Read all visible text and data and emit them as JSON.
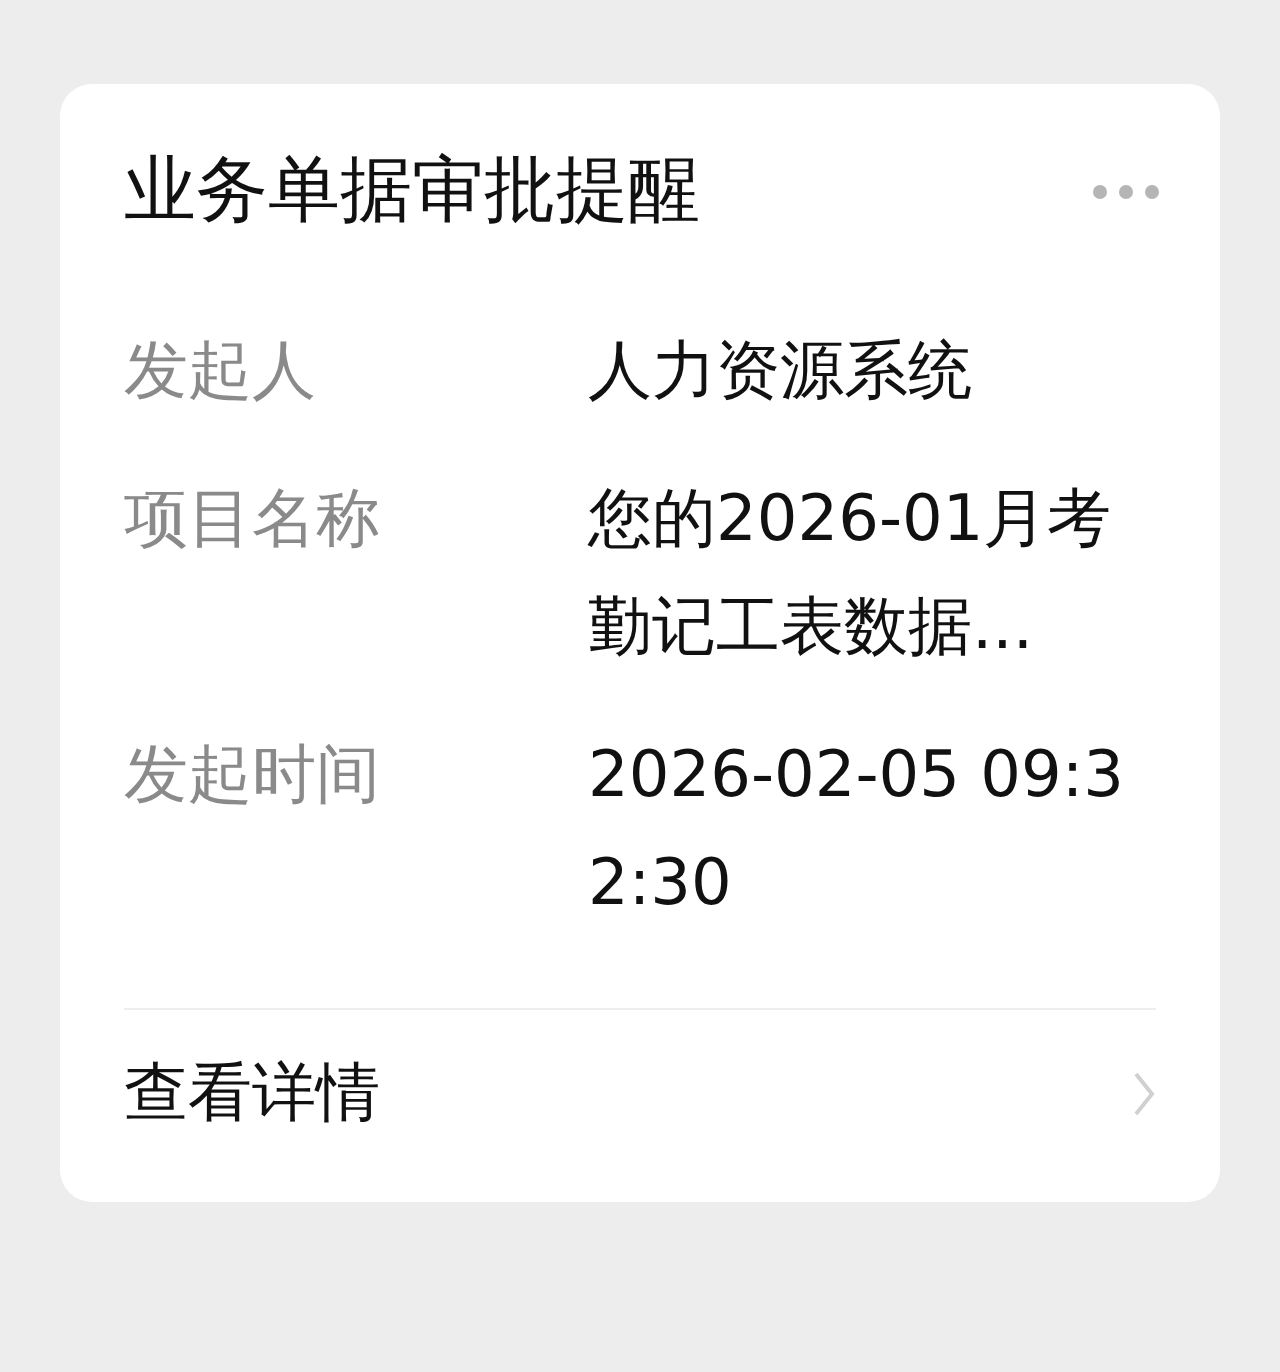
{
  "card": {
    "title": "业务单据审批提醒",
    "fields": [
      {
        "label": "发起人",
        "value": "人力资源系统"
      },
      {
        "label": "项目名称",
        "value": "您的2026-01月考勤记工表数据..."
      },
      {
        "label": "发起时间",
        "value": "2026-02-05 09:32:30"
      }
    ],
    "footer_link": "查看详情"
  }
}
